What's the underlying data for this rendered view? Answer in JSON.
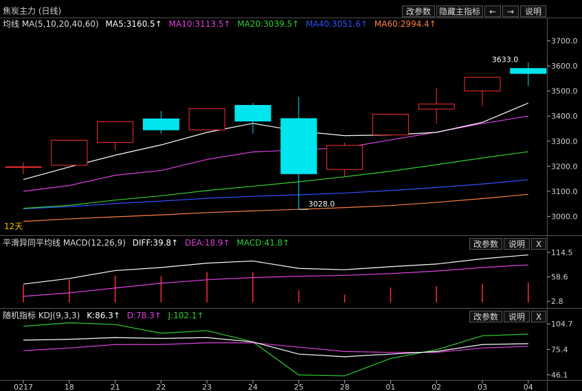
{
  "header": {
    "title": "焦炭主力 (日线)",
    "buttons": {
      "params": "改参数",
      "hide_main": "隐藏主指标",
      "left_arrow": "←",
      "right_arrow": "→",
      "help": "说明"
    }
  },
  "ma_legend": {
    "label": "均线 MA(5,10,20,40,60)",
    "ma5": "MA5:3160.5↑",
    "ma10": "MA10:3113.5↑",
    "ma20": "MA20:3039.5↑",
    "ma40": "MA40:3051.6↑",
    "ma60": "MA60:2994.4↑"
  },
  "period_label": "12天",
  "macd_legend": {
    "label": "平滑异同平均线 MACD(12,26,9)",
    "diff": "DIFF:39.8↑",
    "dea": "DEA:18.9↑",
    "macd": "MACD:41.8↑",
    "buttons": {
      "params": "改参数",
      "help": "说明",
      "close": "X"
    }
  },
  "kdj_legend": {
    "label": "随机指标 KDJ(9,3,3)",
    "k": "K:86.3↑",
    "d": "D:78.3↑",
    "j": "J:102.1↑",
    "buttons": {
      "params": "改参数",
      "help": "说明",
      "close": "X"
    }
  },
  "colors": {
    "background": "#000000",
    "up": "#ff3030",
    "down": "#00e5ee",
    "ma5": "#ffffff",
    "ma10": "#e040e0",
    "ma20": "#30d030",
    "ma40": "#3050ff",
    "ma60": "#ff8040",
    "grid": "#555555"
  },
  "chart_data": [
    {
      "type": "candlestick",
      "categories": [
        "0217",
        "18",
        "21",
        "22",
        "23",
        "24",
        "25",
        "28",
        "01",
        "02",
        "03",
        "04"
      ],
      "x_tick_labels": [
        "0217",
        "18",
        "21",
        "22",
        "23",
        "24",
        "25",
        "28",
        "01",
        "02",
        "03",
        "04"
      ],
      "y_ticks": [
        3000,
        3100,
        3200,
        3300,
        3400,
        3500,
        3600,
        3700
      ],
      "y_tick_labels": [
        "3000.0",
        "3100.0",
        "3200.0",
        "3300.0",
        "3400.0",
        "3500.0",
        "3600.0",
        "3700.0"
      ],
      "ylim": [
        2930,
        3740
      ],
      "candles": [
        {
          "open": 3198,
          "high": 3215,
          "low": 3168,
          "close": 3198
        },
        {
          "open": 3204,
          "high": 3306,
          "low": 3204,
          "close": 3304
        },
        {
          "open": 3295,
          "high": 3378,
          "low": 3263,
          "close": 3378
        },
        {
          "open": 3389,
          "high": 3420,
          "low": 3330,
          "close": 3345
        },
        {
          "open": 3345,
          "high": 3432,
          "low": 3345,
          "close": 3430
        },
        {
          "open": 3443,
          "high": 3452,
          "low": 3330,
          "close": 3380
        },
        {
          "open": 3390,
          "high": 3476,
          "low": 3028,
          "close": 3170
        },
        {
          "open": 3187,
          "high": 3295,
          "low": 3160,
          "close": 3283
        },
        {
          "open": 3325,
          "high": 3410,
          "low": 3325,
          "close": 3408
        },
        {
          "open": 3428,
          "high": 3512,
          "low": 3370,
          "close": 3448
        },
        {
          "open": 3500,
          "high": 3555,
          "low": 3440,
          "close": 3555
        },
        {
          "open": 3590,
          "high": 3614,
          "low": 3520,
          "close": 3570
        }
      ],
      "annotations": [
        {
          "text": "3028.0",
          "x": "25",
          "y": 3028
        },
        {
          "text": "3633.0",
          "x": "04",
          "y": 3610
        }
      ],
      "series": [
        {
          "name": "MA5",
          "values": [
            3147,
            3197,
            3244,
            3285,
            3335,
            3371,
            3340,
            3322,
            3325,
            3335,
            3375,
            3452
          ]
        },
        {
          "name": "MA10",
          "values": [
            3100,
            3123,
            3164,
            3183,
            3227,
            3257,
            3265,
            3274,
            3305,
            3336,
            3370,
            3400
          ]
        },
        {
          "name": "MA20",
          "values": [
            3032,
            3044,
            3065,
            3082,
            3103,
            3120,
            3138,
            3158,
            3180,
            3206,
            3233,
            3258
          ]
        },
        {
          "name": "MA40",
          "values": [
            3030,
            3039,
            3051,
            3061,
            3072,
            3080,
            3086,
            3093,
            3103,
            3115,
            3129,
            3146
          ]
        },
        {
          "name": "MA60",
          "values": [
            2980,
            2990,
            2998,
            3006,
            3015,
            3022,
            3028,
            3035,
            3043,
            3056,
            3071,
            3088
          ]
        }
      ]
    },
    {
      "type": "macd",
      "categories": [
        "0217",
        "18",
        "21",
        "22",
        "23",
        "24",
        "25",
        "28",
        "01",
        "02",
        "03",
        "04"
      ],
      "y_ticks": [
        2.8,
        58.6,
        114.5
      ],
      "y_tick_labels": [
        "2.8",
        "58.6",
        "114.5"
      ],
      "ylim": [
        -8,
        124
      ],
      "series": [
        {
          "name": "DIFF",
          "values": [
            42,
            55,
            73,
            80,
            90,
            95,
            78,
            75,
            82,
            88,
            100,
            109
          ]
        },
        {
          "name": "DEA",
          "values": [
            14,
            22,
            33,
            44,
            52,
            57,
            60,
            62,
            66,
            72,
            80,
            86
          ]
        },
        {
          "name": "MACD",
          "values": [
            40,
            52,
            62,
            60,
            70,
            70,
            28,
            18,
            34,
            37,
            42,
            45
          ]
        }
      ]
    },
    {
      "type": "kdj",
      "categories": [
        "0217",
        "18",
        "21",
        "22",
        "23",
        "24",
        "25",
        "28",
        "01",
        "02",
        "03",
        "04"
      ],
      "y_ticks": [
        46.1,
        75.4,
        104.7
      ],
      "y_tick_labels": [
        "46.1",
        "75.4",
        "104.7"
      ],
      "ylim": [
        41,
        108
      ],
      "series": [
        {
          "name": "K",
          "values": [
            86,
            87,
            89,
            88,
            89,
            84,
            70,
            67,
            70,
            73,
            81,
            82
          ]
        },
        {
          "name": "D",
          "values": [
            74,
            77,
            81,
            81,
            83,
            83,
            78,
            73,
            72,
            72,
            77,
            79
          ]
        },
        {
          "name": "J",
          "values": [
            102,
            106,
            104,
            94,
            97,
            84,
            46,
            45,
            65,
            75,
            91,
            93
          ]
        }
      ]
    }
  ]
}
